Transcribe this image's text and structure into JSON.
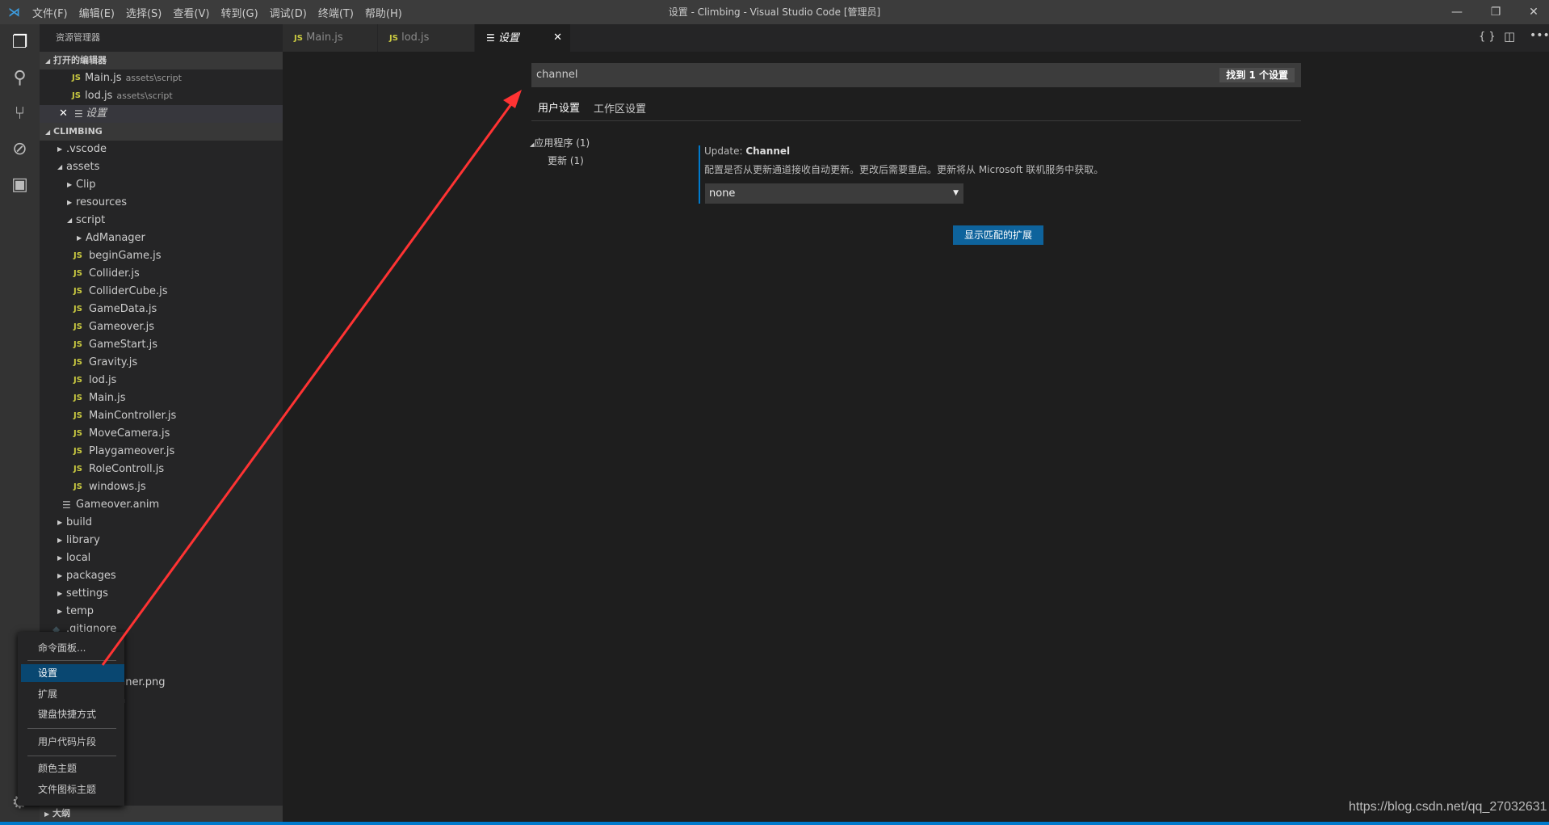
{
  "titlebar": {
    "menus": [
      "文件(F)",
      "编辑(E)",
      "选择(S)",
      "查看(V)",
      "转到(G)",
      "调试(D)",
      "终端(T)",
      "帮助(H)"
    ],
    "title": "设置 - Climbing - Visual Studio Code [管理员]"
  },
  "sidebar": {
    "title": "资源管理器",
    "open_editors_label": "打开的编辑器",
    "open_editors": [
      {
        "name": "Main.js",
        "path": "assets\\script"
      },
      {
        "name": "lod.js",
        "path": "assets\\script"
      },
      {
        "name": "设置"
      }
    ],
    "project_label": "CLIMBING",
    "tree": [
      {
        "name": ".vscode",
        "type": "folder",
        "level": 0,
        "open": false
      },
      {
        "name": "assets",
        "type": "folder",
        "level": 0,
        "open": true
      },
      {
        "name": "Clip",
        "type": "folder",
        "level": 1,
        "open": false
      },
      {
        "name": "resources",
        "type": "folder",
        "level": 1,
        "open": false
      },
      {
        "name": "script",
        "type": "folder",
        "level": 1,
        "open": true
      },
      {
        "name": "AdManager",
        "type": "folder",
        "level": 2,
        "open": false
      },
      {
        "name": "beginGame.js",
        "type": "js",
        "level": 2
      },
      {
        "name": "Collider.js",
        "type": "js",
        "level": 2
      },
      {
        "name": "ColliderCube.js",
        "type": "js",
        "level": 2
      },
      {
        "name": "GameData.js",
        "type": "js",
        "level": 2
      },
      {
        "name": "Gameover.js",
        "type": "js",
        "level": 2
      },
      {
        "name": "GameStart.js",
        "type": "js",
        "level": 2
      },
      {
        "name": "Gravity.js",
        "type": "js",
        "level": 2
      },
      {
        "name": "lod.js",
        "type": "js",
        "level": 2
      },
      {
        "name": "Main.js",
        "type": "js",
        "level": 2
      },
      {
        "name": "MainController.js",
        "type": "js",
        "level": 2
      },
      {
        "name": "MoveCamera.js",
        "type": "js",
        "level": 2
      },
      {
        "name": "Playgameover.js",
        "type": "js",
        "level": 2
      },
      {
        "name": "RoleControll.js",
        "type": "js",
        "level": 2
      },
      {
        "name": "windows.js",
        "type": "js",
        "level": 2
      },
      {
        "name": "Gameover.anim",
        "type": "file",
        "level": 1
      },
      {
        "name": "build",
        "type": "folder",
        "level": 0,
        "open": false
      },
      {
        "name": "library",
        "type": "folder",
        "level": 0,
        "open": false
      },
      {
        "name": "local",
        "type": "folder",
        "level": 0,
        "open": false
      },
      {
        "name": "packages",
        "type": "folder",
        "level": 0,
        "open": false
      },
      {
        "name": "settings",
        "type": "folder",
        "level": 0,
        "open": false
      },
      {
        "name": "temp",
        "type": "folder",
        "level": 0,
        "open": false
      },
      {
        "name": ".gitignore",
        "type": "git",
        "level": 0
      }
    ],
    "partial_rows": [
      "nner.png",
      "n"
    ],
    "outline_label": "大纲"
  },
  "tabs": [
    {
      "label": "Main.js",
      "icon": "js"
    },
    {
      "label": "lod.js",
      "icon": "js"
    },
    {
      "label": "设置",
      "icon": "settings-lines",
      "active": true
    }
  ],
  "settings": {
    "search_value": "channel",
    "result_count": "找到 1 个设置",
    "scope_tabs": [
      "用户设置",
      "工作区设置"
    ],
    "toc": [
      {
        "label": "应用程序 (1)"
      },
      {
        "label": "更新 (1)"
      }
    ],
    "item": {
      "category": "Update: ",
      "name": "Channel",
      "description": "配置是否从更新通道接收自动更新。更改后需要重启。更新将从 Microsoft 联机服务中获取。",
      "value": "none"
    },
    "show_extensions_button": "显示匹配的扩展"
  },
  "context_menu": {
    "items": [
      "命令面板...",
      "设置",
      "扩展",
      "键盘快捷方式",
      "用户代码片段",
      "颜色主题",
      "文件图标主题"
    ],
    "selected": "设置"
  },
  "watermark": "https://blog.csdn.net/qq_27032631",
  "colors": {
    "accent": "#007acc",
    "annotation_arrow": "#ff3333",
    "js_icon": "#cbcb41"
  }
}
